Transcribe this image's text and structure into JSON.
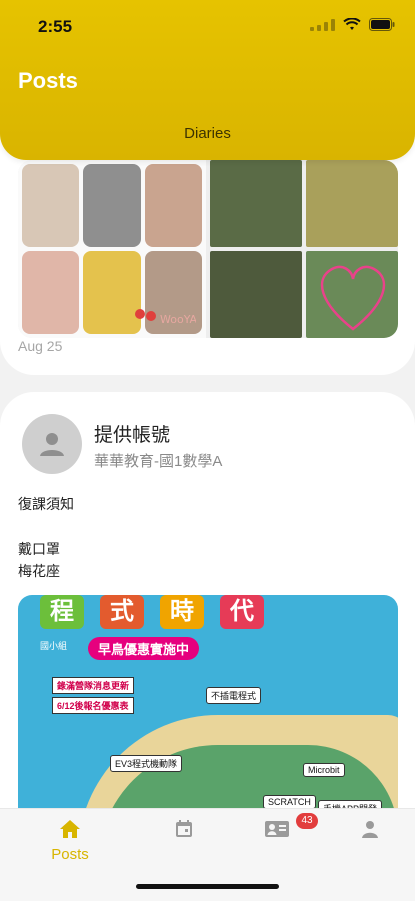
{
  "status": {
    "time": "2:55"
  },
  "header": {
    "title": "Posts",
    "subtitle": "Diaries"
  },
  "card1": {
    "date": "Aug 25"
  },
  "post": {
    "author": "提供帳號",
    "group": "華華教育-國1數學A",
    "lines": [
      "復課須知",
      "戴口罩",
      "梅花座"
    ]
  },
  "banner": {
    "chips": [
      "程",
      "式",
      "時",
      "代"
    ],
    "pill": "早鳥優惠實施中",
    "logo": "國小組",
    "notes": [
      "錄滿營隊消息更新",
      "6/12後報名優惠表"
    ],
    "tags": [
      "不插電程式",
      "EV3程式機動隊",
      "Microbit",
      "SCRATCH",
      "手機APP開發"
    ]
  },
  "tabs": {
    "items": [
      {
        "label": "Posts",
        "icon": "home-icon",
        "active": true
      },
      {
        "label": "",
        "icon": "calendar-icon",
        "active": false
      },
      {
        "label": "",
        "icon": "contacts-icon",
        "active": false,
        "badge": "43"
      },
      {
        "label": "",
        "icon": "profile-icon",
        "active": false
      }
    ]
  },
  "colors": {
    "accent": "#d8b500",
    "header": "#e0be00",
    "badge": "#e23d3d"
  }
}
